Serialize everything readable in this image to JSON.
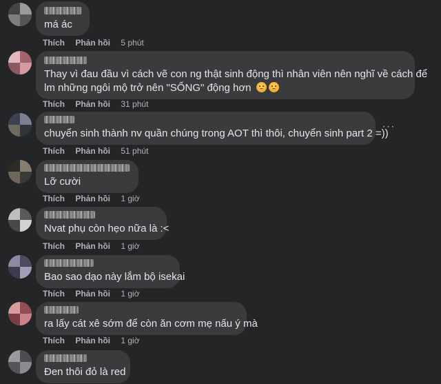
{
  "comments": [
    {
      "text": "má ác",
      "like": "Thích",
      "reply": "Phản hồi",
      "time": "5 phút"
    },
    {
      "text_line1": "Thay vì đau đầu vì cách vẽ con ng thật sinh động thì nhân viên nên nghĩ về cách để",
      "text_line2": "lm những ngôi mộ trở nên \"SỐNG\" động hơn",
      "emojis": [
        "crying-face",
        "crying-face"
      ],
      "like": "Thích",
      "reply": "Phản hồi",
      "time": "31 phút"
    },
    {
      "text": "chuyển sinh thành nv quần chúng trong AOT thì thôi, chuyển sinh part 2 =))",
      "like": "Thích",
      "reply": "Phản hồi",
      "time": "51 phút",
      "more": "···"
    },
    {
      "text": "Lỡ cười",
      "like": "Thích",
      "reply": "Phản hồi",
      "time": "1 giờ"
    },
    {
      "text": "Nvat phụ còn hẹo nữa là :<",
      "like": "Thích",
      "reply": "Phản hồi",
      "time": "1 giờ"
    },
    {
      "text": "Bao sao dạo này lắm bộ isekai",
      "like": "Thích",
      "reply": "Phản hồi",
      "time": "1 giờ"
    },
    {
      "text": "ra lấy cát xê sớm để còn ăn cơm mẹ nấu ý mà",
      "like": "Thích",
      "reply": "Phản hồi",
      "time": "1 giờ"
    },
    {
      "text": "Đen thôi đỏ là red"
    }
  ],
  "colors": {
    "background": "#242526",
    "bubble": "#3a3b3c",
    "text": "#e4e6eb",
    "secondary_text": "#b0b3b8"
  }
}
